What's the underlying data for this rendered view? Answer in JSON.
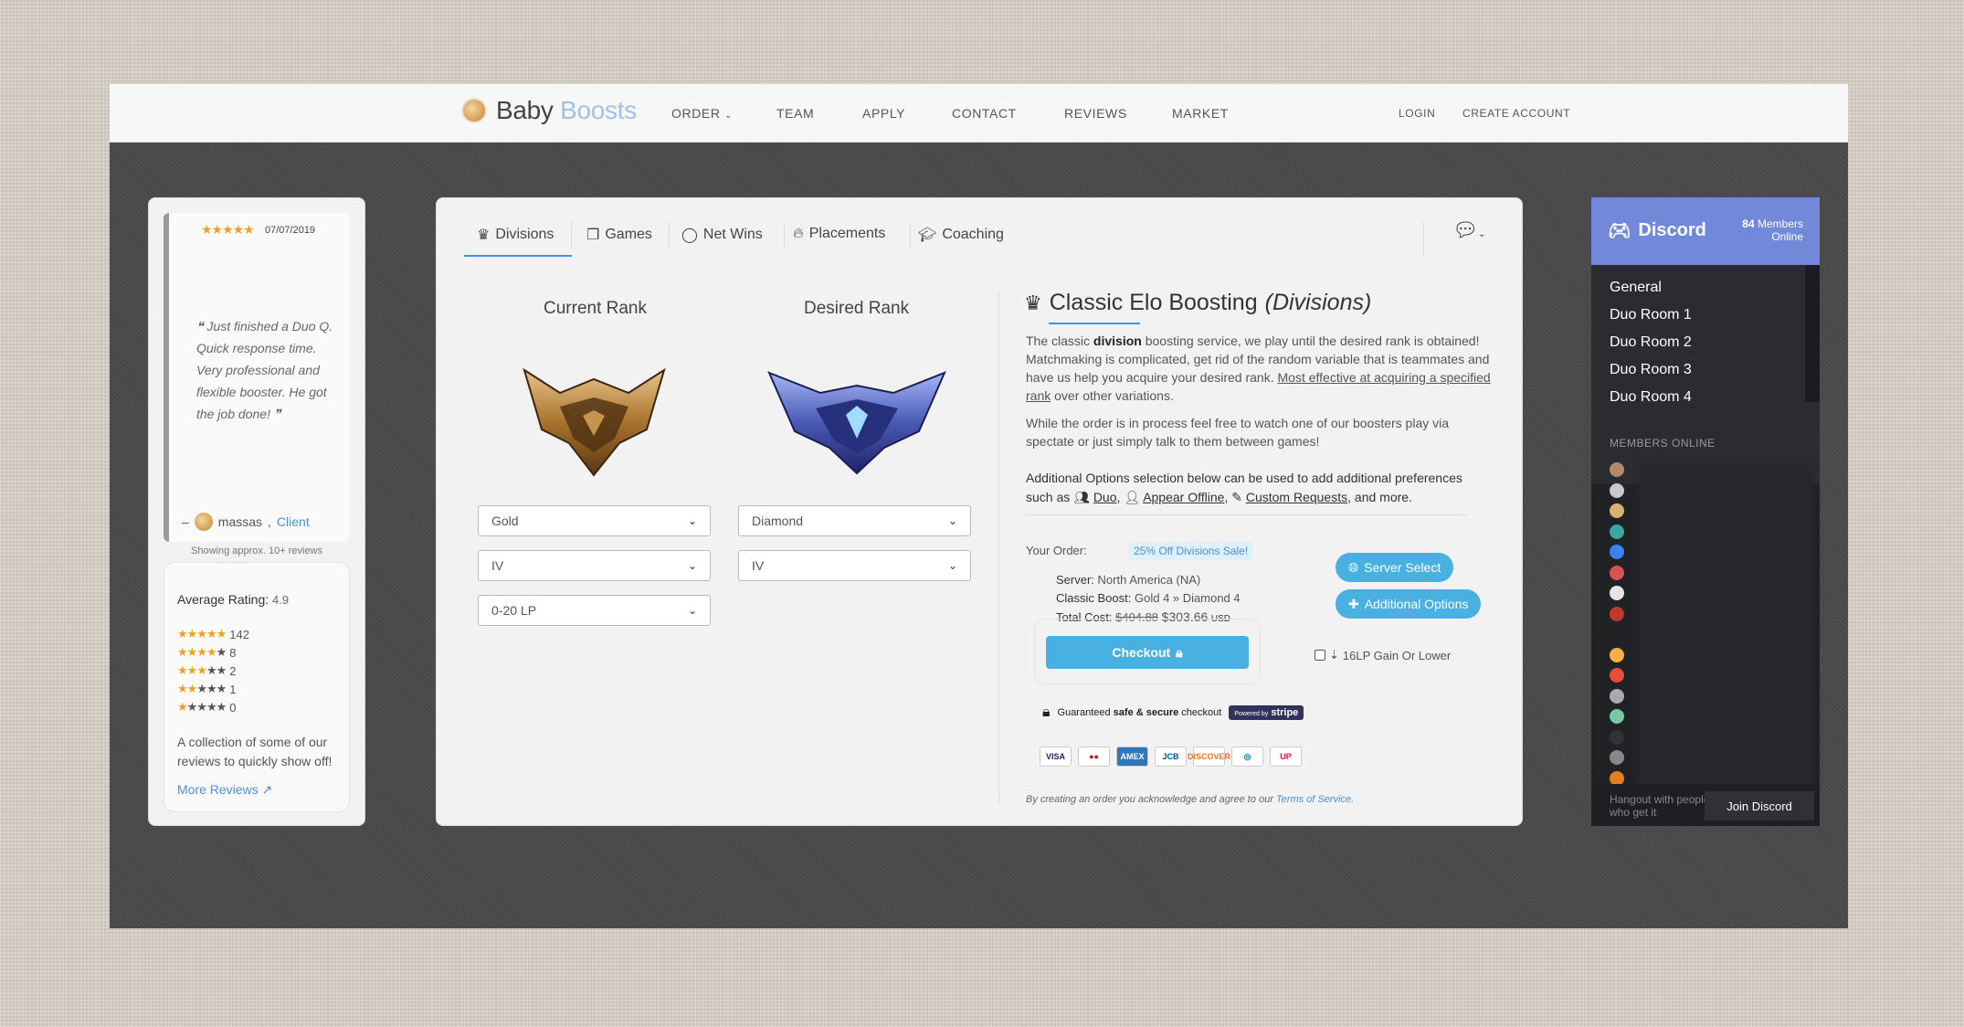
{
  "nav": {
    "brand_main": "Baby",
    "brand_accent": "Boosts",
    "items": [
      "ORDER",
      "TEAM",
      "APPLY",
      "CONTACT",
      "REVIEWS",
      "MARKET"
    ],
    "order_chevron": "⌄",
    "login": "LOGIN",
    "create_account": "CREATE ACCOUNT"
  },
  "review": {
    "stars": "★★★★★",
    "date": "07/07/2019",
    "quote": "❝ Just finished a Duo Q. Quick response time. Very professional and flexible booster. He got the job done! ❞",
    "dash": "–",
    "author": "massas",
    "client_label": "Client",
    "showing": "Showing approx. 10+ reviews",
    "avg_label": "Average Rating:",
    "avg_value": "4.9",
    "rows": [
      {
        "on": "★★★★★",
        "off": "",
        "count": "142"
      },
      {
        "on": "★★★★",
        "off": "★",
        "count": "8"
      },
      {
        "on": "★★★",
        "off": "★★",
        "count": "2"
      },
      {
        "on": "★★",
        "off": "★★★",
        "count": "1"
      },
      {
        "on": "★",
        "off": "★★★★",
        "count": "0"
      }
    ],
    "blurb": "A collection of some of our reviews to quickly show off!",
    "more": "More Reviews"
  },
  "tabs": [
    "Divisions",
    "Games",
    "Net Wins",
    "Placements",
    "Coaching"
  ],
  "current_rank": {
    "title": "Current Rank",
    "tier": "Gold",
    "division": "IV",
    "lp": "0-20 LP"
  },
  "desired_rank": {
    "title": "Desired Rank",
    "tier": "Diamond",
    "division": "IV"
  },
  "service": {
    "title": "Classic Elo Boosting",
    "subtitle": "(Divisions)",
    "p1_a": "The classic ",
    "p1_b": "division",
    "p1_c": " boosting service, we play until the desired rank is obtained! Matchmaking is complicated, get rid of the random variable that is teammates and have us help you acquire your desired rank. ",
    "p1_d": "Most effective at acquiring a specified rank",
    "p1_e": " over other variations.",
    "p2": "While the order is in process feel free to watch one of our boosters play via spectate or just simply talk to them between games!",
    "addl_a": "Additional Options selection below can be used to add additional preferences such as ",
    "addl_duo": "Duo",
    "addl_offline": "Appear Offline",
    "addl_custom": "Custom Requests",
    "addl_end": ", and more."
  },
  "order": {
    "label": "Your Order:",
    "sale": "25% Off Divisions Sale!",
    "server_label": "Server:",
    "server_value": "North America (NA)",
    "boost_label": "Classic Boost:",
    "boost_value": "Gold 4 »  Diamond 4",
    "total_label": "Total Cost:",
    "old_price": "$404.88",
    "new_price": "$303.66",
    "currency": "USD",
    "server_btn": "Server Select",
    "options_btn": "Additional Options",
    "checkout": "Checkout",
    "lp_gain": "16LP Gain Or Lower",
    "secure_a": "Guaranteed ",
    "secure_b": "safe & secure",
    "secure_c": " checkout",
    "stripe_pre": "Powered by",
    "stripe": "stripe",
    "tos_a": "By creating an order you acknowledge and agree to our ",
    "tos_link": "Terms of Service",
    "tos_end": "."
  },
  "payment_cards": [
    {
      "label": "VISA",
      "color": "#1a1f71"
    },
    {
      "label": "●●",
      "color": "#eb001b"
    },
    {
      "label": "AMEX",
      "color": "#ffffff"
    },
    {
      "label": "JCB",
      "color": "#0b4ea2"
    },
    {
      "label": "DISCOVER",
      "color": "#e7752a"
    },
    {
      "label": "◎",
      "color": "#0079be"
    },
    {
      "label": "UP",
      "color": "#e21836"
    }
  ],
  "discord": {
    "logo": "Discord",
    "members_count": "84",
    "members_label": "Members",
    "online_label": "Online",
    "channels": [
      "General",
      "Duo Room 1",
      "Duo Room 2",
      "Duo Room 3",
      "Duo Room 4"
    ],
    "members_online": "MEMBERS ONLINE",
    "hangout": "Hangout with people who get it",
    "join": "Join Discord"
  },
  "colors": {
    "accent": "#49b1e2",
    "link": "#4a90d9",
    "discord": "#7289da",
    "star": "#f0a020"
  }
}
